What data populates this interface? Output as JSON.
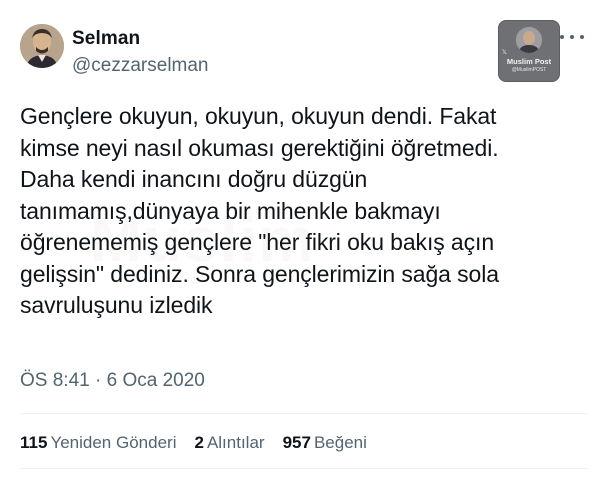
{
  "author": {
    "display_name": "Selman",
    "handle": "@cezzarselman"
  },
  "badge": {
    "title": "Muslim Post",
    "subtitle": "@MuslimPOST",
    "x_mark": "𝕏"
  },
  "tweet": {
    "lines": [
      "Gençlere okuyun, okuyun, okuyun dendi. Fakat",
      "kimse neyi nasıl okuması gerektiğini öğretmedi.",
      "Daha kendi inancını doğru düzgün",
      "tanımamış,dünyaya bir mihenkle bakmayı",
      "öğrenememiş gençlere \"her fikri oku bakış açın",
      "gelişsin\" dediniz. Sonra gençlerimizin sağa sola",
      "savruluşunu izledik"
    ],
    "watermark": "Muslim"
  },
  "timestamp": "ÖS 8:41 · 6 Oca 2020",
  "stats": {
    "retweets_count": "115",
    "retweets_label": "Yeniden Gönderi",
    "quotes_count": "2",
    "quotes_label": "Alıntılar",
    "likes_count": "957",
    "likes_label": "Beğeni"
  },
  "colors": {
    "text": "#0f1419",
    "secondary": "#536471",
    "divider": "#eff3f4"
  }
}
